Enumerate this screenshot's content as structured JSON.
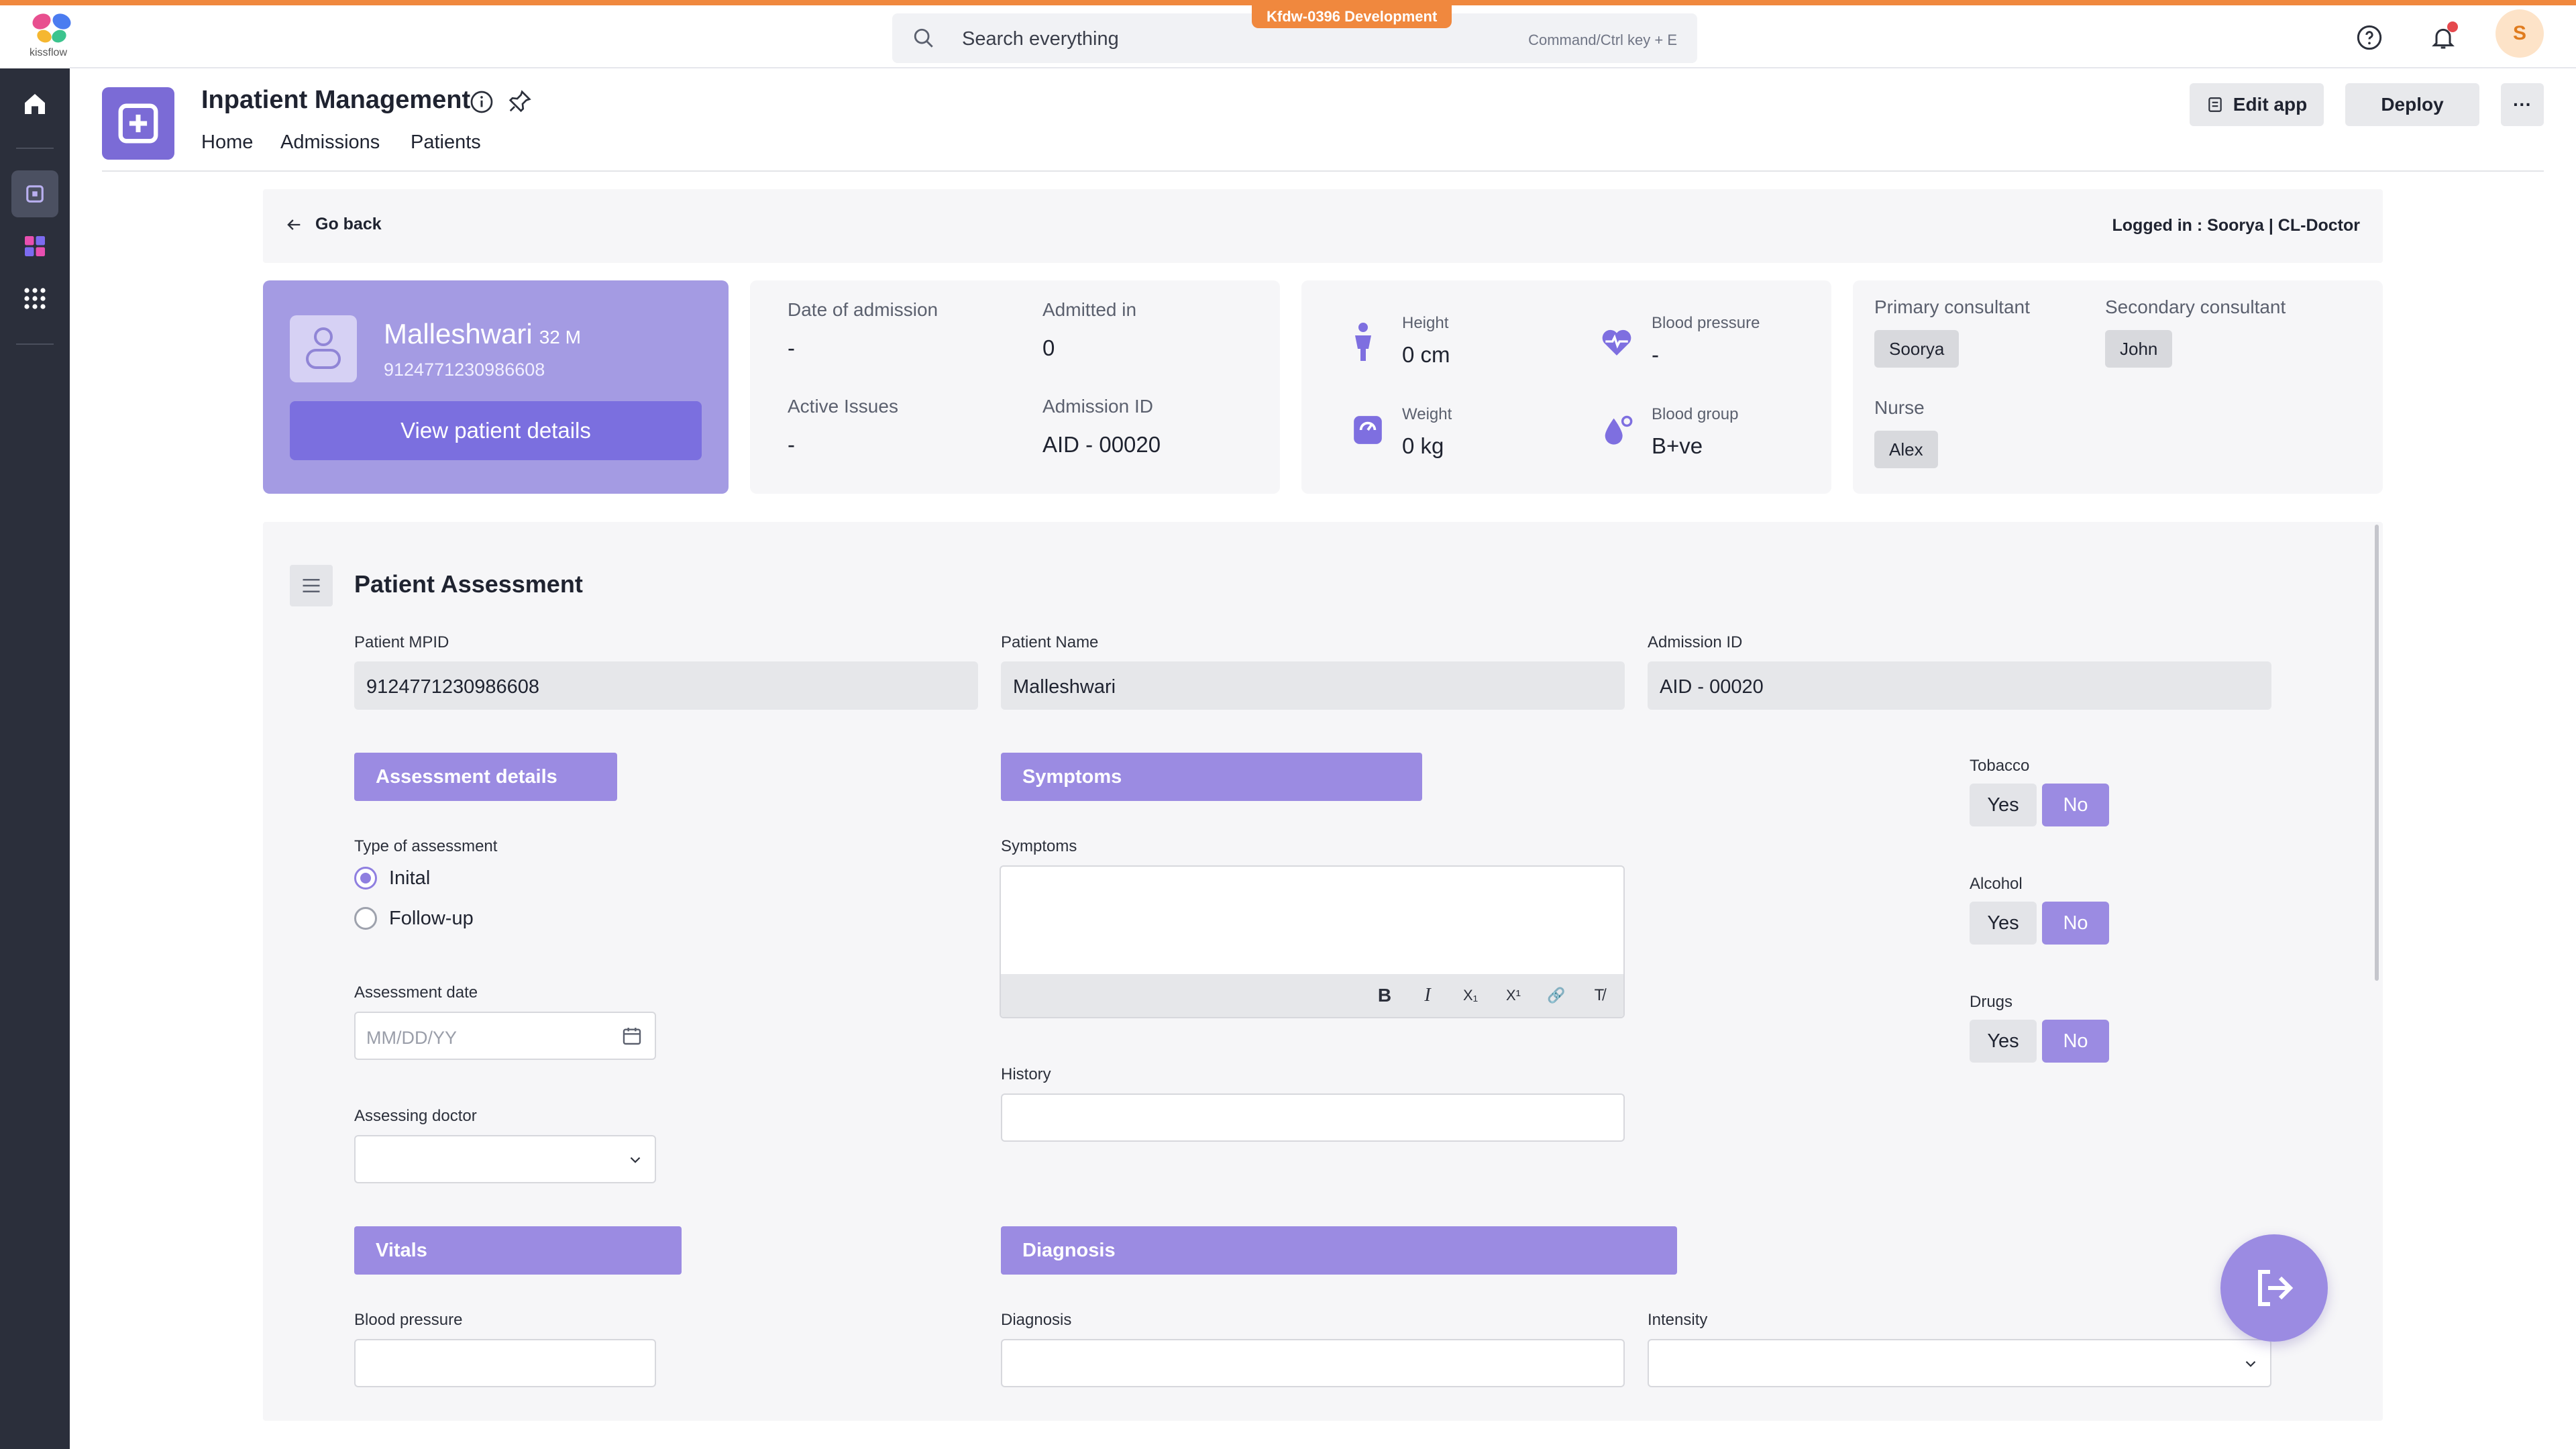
{
  "env_badge": "Kfdw-0396 Development",
  "logo": {
    "text": "kissflow"
  },
  "search": {
    "placeholder": "Search everything",
    "shortcut": "Command/Ctrl key + E"
  },
  "user": {
    "initial": "S"
  },
  "app": {
    "title": "Inpatient Management",
    "nav": [
      "Home",
      "Admissions",
      "Patients"
    ],
    "edit_label": "Edit app",
    "deploy_label": "Deploy",
    "more_label": "···"
  },
  "page": {
    "go_back": "Go back",
    "logged_in": "Logged in : Soorya | CL-Doctor"
  },
  "patient": {
    "name": "Malleshwari",
    "age_gender": "32 M",
    "mpid": "9124771230986608",
    "view_details": "View patient details"
  },
  "admission": {
    "date_label": "Date of admission",
    "date_value": "-",
    "admitted_label": "Admitted in",
    "admitted_value": "0",
    "issues_label": "Active Issues",
    "issues_value": "-",
    "id_label": "Admission ID",
    "id_value": "AID - 00020"
  },
  "vitals_card": {
    "height_label": "Height",
    "height_value": "0 cm",
    "bp_label": "Blood pressure",
    "bp_value": "-",
    "weight_label": "Weight",
    "weight_value": "0 kg",
    "bg_label": "Blood group",
    "bg_value": "B+ve"
  },
  "care_team": {
    "primary_label": "Primary consultant",
    "primary_value": "Soorya",
    "secondary_label": "Secondary consultant",
    "secondary_value": "John",
    "nurse_label": "Nurse",
    "nurse_value": "Alex"
  },
  "form": {
    "title": "Patient Assessment",
    "mpid_label": "Patient MPID",
    "mpid_value": "9124771230986608",
    "name_label": "Patient Name",
    "name_value": "Malleshwari",
    "admission_label": "Admission ID",
    "admission_value": "AID - 00020",
    "assessment_details": "Assessment details",
    "type_label": "Type of assessment",
    "type_options": [
      "Inital",
      "Follow-up"
    ],
    "date_label": "Assessment date",
    "date_placeholder": "MM/DD/YY",
    "doctor_label": "Assessing doctor",
    "symptoms_head": "Symptoms",
    "symptoms_label": "Symptoms",
    "rte_tools": [
      "B",
      "I",
      "X₁",
      "X¹",
      "🔗",
      "T̸"
    ],
    "history_label": "History",
    "tobacco_label": "Tobacco",
    "alcohol_label": "Alcohol",
    "drugs_label": "Drugs",
    "yes": "Yes",
    "no": "No",
    "vitals_head": "Vitals",
    "bp_label": "Blood pressure",
    "diagnosis_head": "Diagnosis",
    "diagnosis_label": "Diagnosis",
    "intensity_label": "Intensity"
  },
  "colors": {
    "accent": "#9b8be2",
    "brand_orange": "#f0883e",
    "sidebar": "#2b2f3b"
  }
}
